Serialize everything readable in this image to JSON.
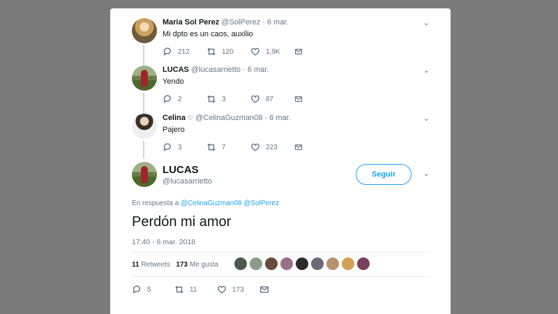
{
  "tweets": [
    {
      "name": "Maria Sol Perez",
      "handle": "@SolPerez",
      "date": "6 mar.",
      "text": "Mi dpto es un caos, auxilio",
      "replies": "212",
      "retweets": "120",
      "likes": "1,9K"
    },
    {
      "name": "LUCAS",
      "handle": "@lucasarrietto",
      "date": "6 mar.",
      "text": "Yendo",
      "replies": "2",
      "retweets": "3",
      "likes": "87"
    },
    {
      "name": "Celina",
      "handle": "@CelinaGuzman08",
      "date": "6 mar.",
      "text": "Pajero",
      "replies": "3",
      "retweets": "7",
      "likes": "223"
    }
  ],
  "main": {
    "name": "LUCAS",
    "handle": "@lucasarrietto",
    "follow_label": "Seguir",
    "reply_prefix": "En respuesta a",
    "mention_1": "@CelinaGuzman08",
    "mention_2": "@SolPerez",
    "text": "Perdón mi amor",
    "timestamp": "17:40 - 6 mar. 2018",
    "retweets_count": "11",
    "retweets_label": "Retweets",
    "likes_count": "173",
    "likes_label": "Me gusta",
    "replies": "5",
    "retweets": "11",
    "likes": "173"
  },
  "colors": {
    "accent": "#1da1f2",
    "muted": "#657786",
    "backdrop": "#7b7b7b"
  },
  "likers_colors": [
    "#4a5a4d",
    "#8d9a86",
    "#6b4a3c",
    "#9a6f88",
    "#2b2b2b",
    "#6a6a7a",
    "#b79270",
    "#d4a052",
    "#7a3f5c"
  ]
}
